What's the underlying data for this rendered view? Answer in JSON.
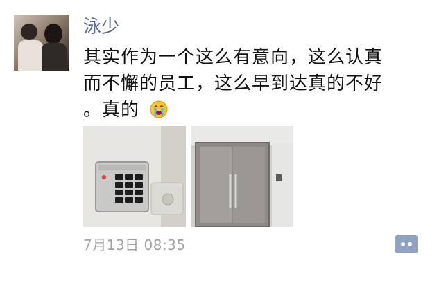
{
  "post": {
    "author": "泳少",
    "text_lines": [
      "其实作为一个这么有意向，这么认真",
      "而不懈的员工，这么早到达真的不好",
      "。真的"
    ],
    "emoji": "crying-face-icon",
    "photos": [
      {
        "name": "keypad-door-lock-photo"
      },
      {
        "name": "glass-office-door-photo"
      }
    ],
    "timestamp": "7月13日 08:35",
    "comment_icon": "comment-icon"
  },
  "colors": {
    "author": "#576b95",
    "text": "#111111",
    "timestamp": "#a3a3a3",
    "comment_button": "#8fa3c0"
  }
}
